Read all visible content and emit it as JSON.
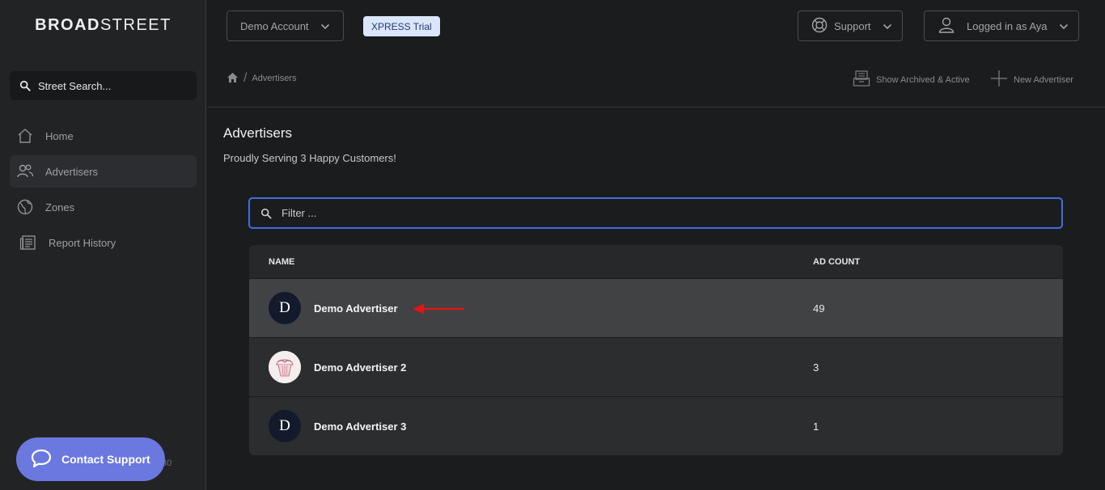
{
  "sidebar": {
    "logo_bold": "BROAD",
    "logo_thin": "STREET",
    "search_placeholder": "Street Search...",
    "items": [
      {
        "label": "Home",
        "icon": "home-icon",
        "active": false
      },
      {
        "label": "Advertisers",
        "icon": "users-icon",
        "active": true
      },
      {
        "label": "Zones",
        "icon": "globe-icon",
        "active": false
      },
      {
        "label": "Report History",
        "icon": "report-icon",
        "active": false
      }
    ],
    "version_text": "30",
    "contact_label": "Contact Support"
  },
  "topbar": {
    "account_label": "Demo Account",
    "trial_badge": "XPRESS Trial",
    "support_label": "Support",
    "user_label": "Logged in as Aya"
  },
  "breadcrumb": {
    "current": "Advertisers"
  },
  "actions": {
    "show_archived": "Show Archived & Active",
    "new_advertiser": "New Advertiser"
  },
  "page": {
    "title": "Advertisers",
    "subtitle": "Proudly Serving 3 Happy Customers!",
    "filter_placeholder": "Filter ..."
  },
  "table": {
    "columns": [
      "NAME",
      "AD COUNT"
    ],
    "rows": [
      {
        "initial": "D",
        "name": "Demo Advertiser",
        "count": "49",
        "avatar": "letter"
      },
      {
        "initial": "",
        "name": "Demo Advertiser 2",
        "count": "3",
        "avatar": "image"
      },
      {
        "initial": "D",
        "name": "Demo Advertiser 3",
        "count": "1",
        "avatar": "letter"
      }
    ]
  },
  "colors": {
    "accent": "#3e6fe0",
    "contact_button": "#6b78e0",
    "annotation_arrow": "#e01515"
  }
}
